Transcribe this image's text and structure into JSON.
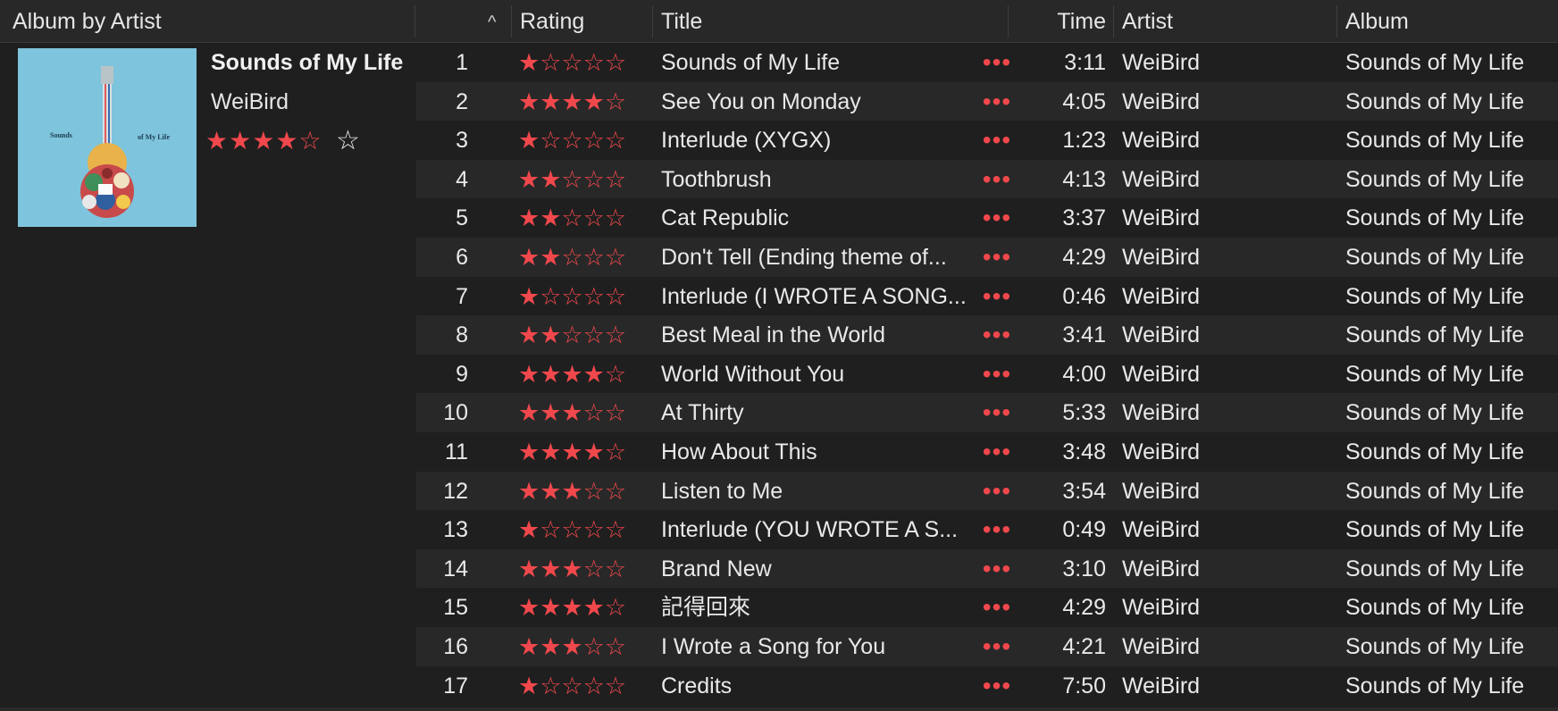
{
  "header": {
    "group_label": "Album by Artist",
    "sort_indicator": "^",
    "columns": {
      "rating": "Rating",
      "title": "Title",
      "time": "Time",
      "artist": "Artist",
      "album": "Album"
    }
  },
  "album": {
    "title": "Sounds of My Life",
    "artist": "WeiBird",
    "rating": 4,
    "rating_max": 5,
    "favorite_icon": "star-outline-icon",
    "cover_text_left": "Sounds",
    "cover_text_right": "of My Life",
    "cover_color": "#7ec4dc"
  },
  "colors": {
    "accent": "#f0484c",
    "row_alt": "#282828",
    "row_base": "#1f1f1f"
  },
  "more_icon": "ellipsis-icon",
  "tracks": [
    {
      "num": "1",
      "rating": 1,
      "title": "Sounds of My Life",
      "time": "3:11",
      "artist": "WeiBird",
      "album": "Sounds of My Life"
    },
    {
      "num": "2",
      "rating": 4,
      "title": "See You on Monday",
      "time": "4:05",
      "artist": "WeiBird",
      "album": "Sounds of My Life"
    },
    {
      "num": "3",
      "rating": 1,
      "title": "Interlude (XYGX)",
      "time": "1:23",
      "artist": "WeiBird",
      "album": "Sounds of My Life"
    },
    {
      "num": "4",
      "rating": 2,
      "title": "Toothbrush",
      "time": "4:13",
      "artist": "WeiBird",
      "album": "Sounds of My Life"
    },
    {
      "num": "5",
      "rating": 2,
      "title": "Cat Republic",
      "time": "3:37",
      "artist": "WeiBird",
      "album": "Sounds of My Life"
    },
    {
      "num": "6",
      "rating": 2,
      "title": "Don't Tell (Ending theme of...",
      "time": "4:29",
      "artist": "WeiBird",
      "album": "Sounds of My Life"
    },
    {
      "num": "7",
      "rating": 1,
      "title": "Interlude (I WROTE A SONG...",
      "time": "0:46",
      "artist": "WeiBird",
      "album": "Sounds of My Life"
    },
    {
      "num": "8",
      "rating": 2,
      "title": "Best Meal in the World",
      "time": "3:41",
      "artist": "WeiBird",
      "album": "Sounds of My Life"
    },
    {
      "num": "9",
      "rating": 4,
      "title": "World Without You",
      "time": "4:00",
      "artist": "WeiBird",
      "album": "Sounds of My Life"
    },
    {
      "num": "10",
      "rating": 3,
      "title": "At Thirty",
      "time": "5:33",
      "artist": "WeiBird",
      "album": "Sounds of My Life"
    },
    {
      "num": "11",
      "rating": 4,
      "title": "How About This",
      "time": "3:48",
      "artist": "WeiBird",
      "album": "Sounds of My Life"
    },
    {
      "num": "12",
      "rating": 3,
      "title": "Listen to Me",
      "time": "3:54",
      "artist": "WeiBird",
      "album": "Sounds of My Life"
    },
    {
      "num": "13",
      "rating": 1,
      "title": "Interlude (YOU WROTE A S...",
      "time": "0:49",
      "artist": "WeiBird",
      "album": "Sounds of My Life"
    },
    {
      "num": "14",
      "rating": 3,
      "title": "Brand New",
      "time": "3:10",
      "artist": "WeiBird",
      "album": "Sounds of My Life"
    },
    {
      "num": "15",
      "rating": 4,
      "title": "記得回來",
      "time": "4:29",
      "artist": "WeiBird",
      "album": "Sounds of My Life"
    },
    {
      "num": "16",
      "rating": 3,
      "title": "I Wrote a Song for You",
      "time": "4:21",
      "artist": "WeiBird",
      "album": "Sounds of My Life"
    },
    {
      "num": "17",
      "rating": 1,
      "title": "Credits",
      "time": "7:50",
      "artist": "WeiBird",
      "album": "Sounds of My Life"
    }
  ]
}
